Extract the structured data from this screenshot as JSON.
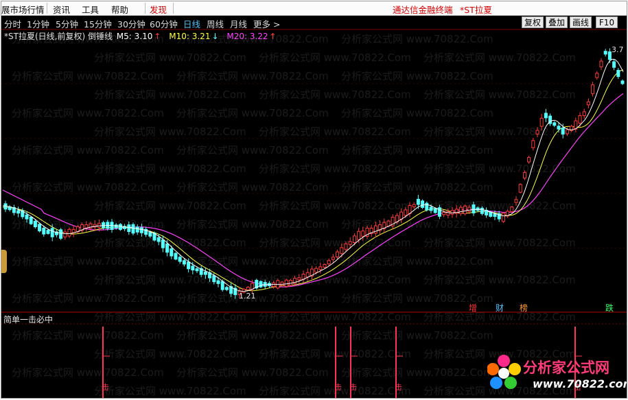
{
  "menubar": {
    "items": [
      "展市场行情",
      "资讯",
      "工具",
      "帮助"
    ],
    "discover": "发现",
    "terminal_title": "通达信金融终端",
    "stock_name": "*ST拉夏"
  },
  "periods": {
    "items": [
      "分时",
      "1分钟",
      "5分钟",
      "15分钟",
      "30分钟",
      "60分钟",
      "日线",
      "周线",
      "月线",
      "更多 >"
    ],
    "active": "日线"
  },
  "toolbar": {
    "buttons": [
      "复权",
      "叠加",
      "画线",
      "F10"
    ]
  },
  "info": {
    "title": "*ST拉夏(日线,前复权) 倒锤线",
    "ma5_label": "M5: 3.10",
    "ma5_arrow": "↑",
    "ma10_label": "M10: 3.21",
    "ma10_arrow": "↓",
    "ma20_label": "M20: 3.22",
    "ma20_arrow": "↑"
  },
  "annotations": {
    "high_label": "3.7",
    "low_label": "1.21"
  },
  "event_markers": [
    {
      "text": "增",
      "color": "#ff3333"
    },
    {
      "text": "财",
      "color": "#4fc3f7"
    },
    {
      "text": "榜",
      "color": "#ff9933"
    },
    {
      "text": "跌",
      "color": "#33ff66"
    }
  ],
  "indicator": {
    "title": "简单一击必中",
    "signal_label": "击",
    "signal_count": 5
  },
  "watermark": "分析家公式网 www.70822.Com",
  "logo": {
    "brand": "分析家公式网",
    "url": "www.70822.com"
  },
  "colors": {
    "up": "#ff3b3b",
    "down": "#54ffff",
    "ma5": "#ffffff",
    "ma10": "#ffff40",
    "ma20": "#ff40ff",
    "grid": "#7a0000",
    "active": "#4fc3f7"
  },
  "chart_data": {
    "type": "candlestick",
    "price_range": [
      1.21,
      3.7
    ],
    "series": [
      "M5",
      "M10",
      "M20"
    ]
  }
}
